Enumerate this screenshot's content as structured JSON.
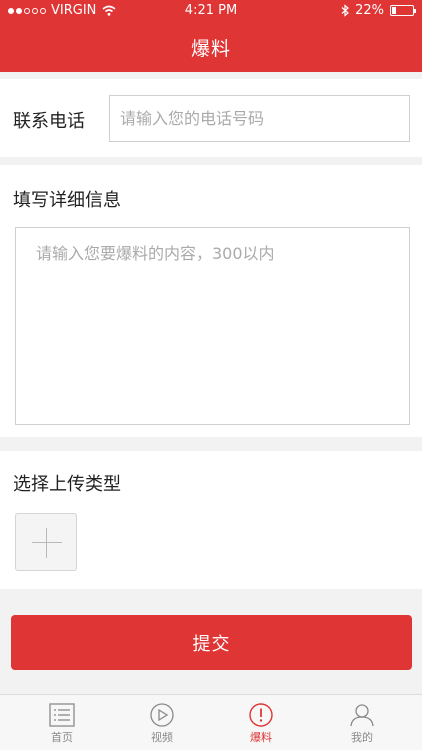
{
  "status_bar": {
    "carrier": "VIRGIN",
    "time": "4:21 PM",
    "battery_text": "22%",
    "battery_level": 0.22
  },
  "header": {
    "title": "爆料"
  },
  "form": {
    "phone_label": "联系电话",
    "phone_placeholder": "请输入您的电话号码",
    "phone_value": "",
    "detail_label": "填写详细信息",
    "detail_placeholder": "请输入您要爆料的内容，300以内",
    "detail_value": "",
    "type_label": "选择上传类型",
    "add_icon": "plus-icon",
    "submit_label": "提交"
  },
  "tabs": [
    {
      "label": "首页",
      "icon": "list-icon",
      "active": false
    },
    {
      "label": "视频",
      "icon": "play-icon",
      "active": false
    },
    {
      "label": "爆料",
      "icon": "alert-icon",
      "active": true
    },
    {
      "label": "我的",
      "icon": "user-icon",
      "active": false
    }
  ],
  "colors": {
    "accent": "#df3535",
    "tab_inactive": "#8a8a8a"
  }
}
